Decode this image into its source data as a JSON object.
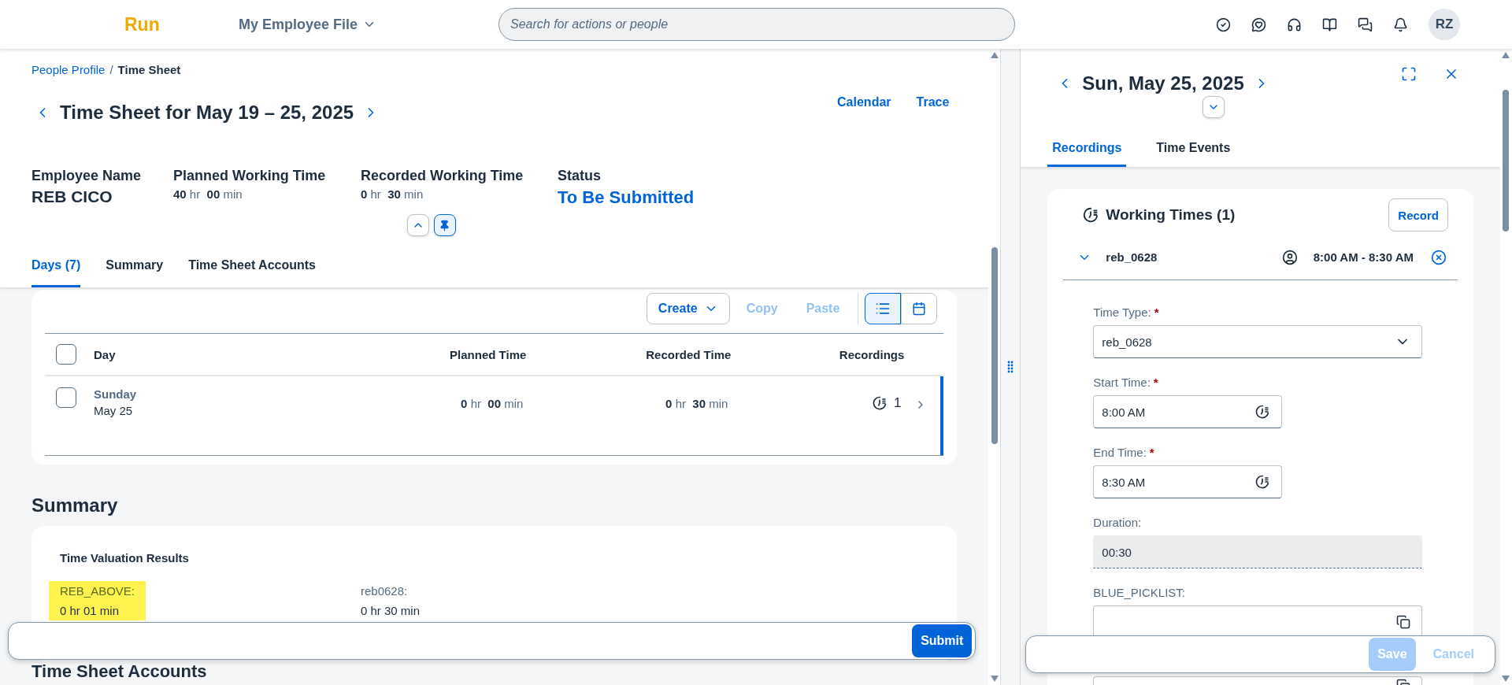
{
  "shell": {
    "logo": "Run",
    "app_title": "My Employee File",
    "search": {
      "placeholder": "Search for actions or people"
    },
    "avatar": "RZ"
  },
  "breadcrumb": {
    "separator": "/",
    "items": [
      {
        "label": "People Profile",
        "current": false
      },
      {
        "label": "Time Sheet",
        "current": true
      }
    ]
  },
  "page": {
    "title": "Time Sheet for May 19 – 25, 2025",
    "actions": [
      "Calendar",
      "Trace"
    ]
  },
  "header_fields": [
    {
      "kind": "name",
      "label": "Employee Name",
      "value": "REB CICO"
    },
    {
      "kind": "duration",
      "label": "Planned Working Time",
      "hours": "40",
      "hr": "hr",
      "minutes": "00",
      "min": "min"
    },
    {
      "kind": "duration",
      "label": "Recorded Working Time",
      "hours": "0",
      "hr": "hr",
      "minutes": "30",
      "min": "min"
    },
    {
      "kind": "status",
      "label": "Status",
      "value": "To Be Submitted"
    }
  ],
  "header_pinned": true,
  "tabs": [
    {
      "label": "Days (7)",
      "selected": true
    },
    {
      "label": "Summary",
      "selected": false
    },
    {
      "label": "Time Sheet Accounts",
      "selected": false
    }
  ],
  "toolbar": {
    "buttons": [
      {
        "kind": "menu",
        "label": "Create",
        "disabled": false
      },
      {
        "kind": "plain",
        "label": "Copy",
        "disabled": true
      },
      {
        "kind": "plain",
        "label": "Paste",
        "disabled": true
      }
    ],
    "views": [
      {
        "kind": "list",
        "selected": true
      },
      {
        "kind": "calendar",
        "selected": false
      }
    ]
  },
  "table": {
    "select_all_checked": false,
    "columns": [
      "Day",
      "Planned Time",
      "Recorded Time",
      "Recordings"
    ],
    "rows": [
      {
        "weekday": "Sunday",
        "date": "May 25",
        "planned": {
          "hours": "0",
          "hr": "hr",
          "minutes": "00",
          "min": "min"
        },
        "recorded": {
          "hours": "0",
          "hr": "hr",
          "minutes": "30",
          "min": "min"
        },
        "recordings": "1",
        "checked": false,
        "navigated": true
      }
    ]
  },
  "summary": {
    "heading": "Summary",
    "card_title": "Time Valuation Results",
    "results": [
      {
        "label": "REB_ABOVE:",
        "value": "0 hr 01 min",
        "highlighted": true
      },
      {
        "label": "reb0628:",
        "value": "0 hr 30 min",
        "highlighted": false
      }
    ]
  },
  "next_section": "Time Sheet Accounts",
  "footer": {
    "submit": "Submit"
  },
  "detail": {
    "title": "Sun, May 25, 2025",
    "tabs": [
      {
        "label": "Recordings",
        "selected": true
      },
      {
        "label": "Time Events",
        "selected": false
      }
    ],
    "working_times": {
      "title": "Working Times (1)",
      "record": "Record",
      "entries": [
        {
          "name": "reb_0628",
          "time": "8:00 AM - 8:30 AM",
          "expanded": true
        }
      ]
    },
    "required_mark": "*",
    "form": [
      {
        "kind": "select",
        "label": "Time Type:",
        "required": true,
        "value": "reb_0628"
      },
      {
        "kind": "time",
        "label": "Start Time:",
        "required": true,
        "value": "8:00 AM"
      },
      {
        "kind": "time",
        "label": "End Time:",
        "required": true,
        "value": "8:30 AM"
      },
      {
        "kind": "readonly",
        "label": "Duration:",
        "required": false,
        "value": "00:30"
      },
      {
        "kind": "picklist",
        "label": "BLUE_PICKLIST:",
        "required": false
      },
      {
        "kind": "picklist"
      }
    ],
    "footer": {
      "save": {
        "label": "Save",
        "disabled": true
      },
      "cancel": {
        "label": "Cancel",
        "disabled": true
      }
    }
  }
}
